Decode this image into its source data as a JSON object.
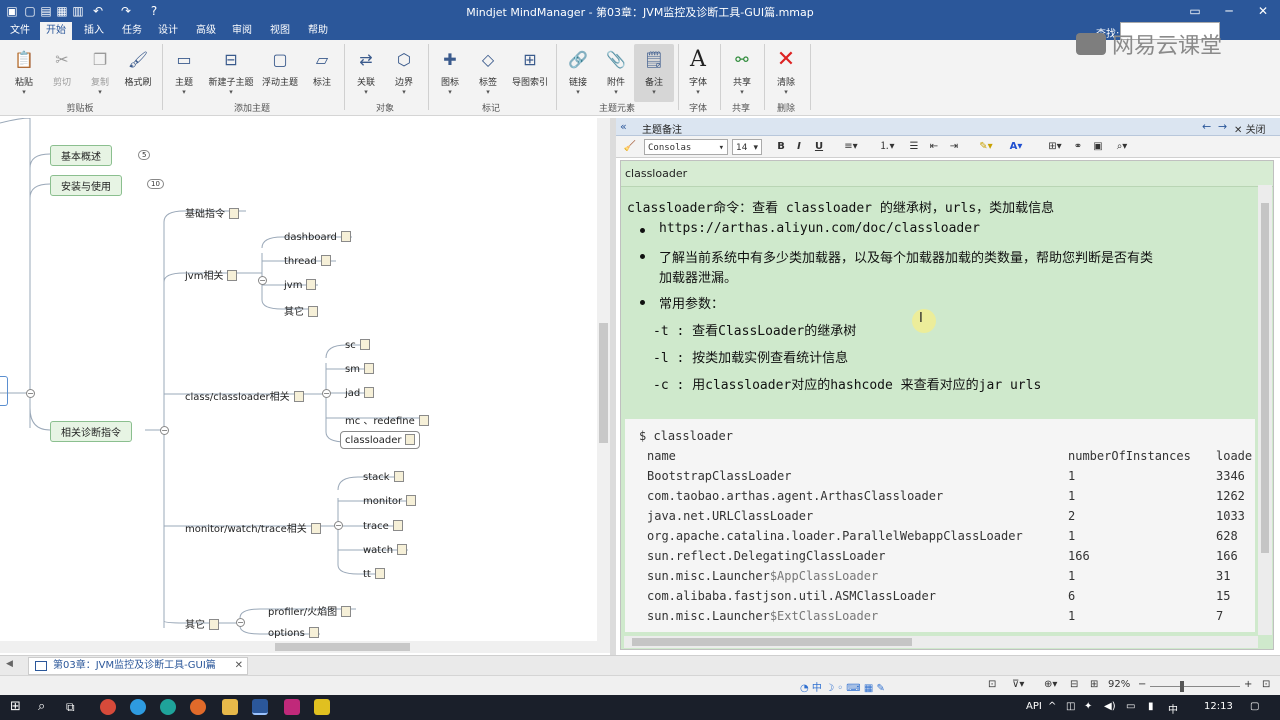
{
  "window": {
    "title": "Mindjet MindManager - 第03章：JVM监控及诊断工具-GUI篇.mmap",
    "search_label": "查找:"
  },
  "menu_tabs": [
    "文件",
    "开始",
    "插入",
    "任务",
    "设计",
    "高级",
    "审阅",
    "视图",
    "帮助"
  ],
  "ribbon": {
    "buttons": [
      {
        "label": "粘贴",
        "icon": "paste-icon"
      },
      {
        "label": "剪切",
        "icon": "cut-icon"
      },
      {
        "label": "复制",
        "icon": "copy-icon"
      },
      {
        "label": "格式刷",
        "icon": "format-painter-icon"
      },
      {
        "label": "主题",
        "icon": "topic-icon"
      },
      {
        "label": "新建子主题",
        "icon": "subtopic-icon"
      },
      {
        "label": "浮动主题",
        "icon": "floating-topic-icon"
      },
      {
        "label": "标注",
        "icon": "callout-icon"
      },
      {
        "label": "关联",
        "icon": "relationship-icon"
      },
      {
        "label": "边界",
        "icon": "boundary-icon"
      },
      {
        "label": "图标",
        "icon": "icon-icon"
      },
      {
        "label": "标签",
        "icon": "tag-icon"
      },
      {
        "label": "导图索引",
        "icon": "map-index-icon"
      },
      {
        "label": "链接",
        "icon": "link-icon"
      },
      {
        "label": "附件",
        "icon": "attachment-icon"
      },
      {
        "label": "备注",
        "icon": "notes-icon"
      },
      {
        "label": "字体",
        "icon": "font-icon"
      },
      {
        "label": "共享",
        "icon": "share-icon"
      },
      {
        "label": "清除",
        "icon": "clear-icon"
      }
    ],
    "groups": [
      "剪贴板",
      "添加主题",
      "对象",
      "标记",
      "主题元素",
      "字体",
      "共享",
      "删除"
    ]
  },
  "brand": "网易云课堂",
  "mindmap": {
    "main_nodes": [
      {
        "label": "基本概述",
        "badge": "5"
      },
      {
        "label": "安装与使用",
        "badge": "10"
      },
      {
        "label": "相关诊断指令"
      }
    ],
    "branches": [
      "基础指令",
      "jvm相关",
      "class/classloader相关",
      "monitor/watch/trace相关",
      "其它"
    ],
    "leaves_jvm": [
      "dashboard",
      "thread",
      "jvm",
      "其它"
    ],
    "leaves_class": [
      "sc",
      "sm",
      "jad",
      "mc 、redefine",
      "classloader"
    ],
    "leaves_monitor": [
      "stack",
      "monitor",
      "trace",
      "watch",
      "tt"
    ],
    "leaves_other": [
      "profiler/火焰图",
      "options"
    ]
  },
  "notes": {
    "pane_title": "主题备注",
    "close_label": "关闭",
    "font_name": "Consolas",
    "font_size": "14",
    "topic_header": "classloader",
    "intro": "classloader命令：查看 classloader 的继承树，urls，类加载信息",
    "bullets": [
      "https://arthas.aliyun.com/doc/classloader",
      "了解当前系统中有多少类加载器，以及每个加载器加载的类数量，帮助您判断是否有类",
      "加载器泄漏。",
      "常用参数："
    ],
    "params": [
      "-t : 查看ClassLoader的继承树",
      "-l : 按类加载实例查看统计信息",
      "-c : 用classloader对应的hashcode 来查看对应的jar urls"
    ],
    "code": {
      "command": "$ classloader",
      "columns": [
        "name",
        "numberOfInstances",
        "loade"
      ],
      "rows": [
        {
          "name": "BootstrapClassLoader",
          "count": "1",
          "loaded": "3346"
        },
        {
          "name": "com.taobao.arthas.agent.ArthasClassloader",
          "count": "1",
          "loaded": "1262"
        },
        {
          "name": "java.net.URLClassLoader",
          "count": "2",
          "loaded": "1033"
        },
        {
          "name": "org.apache.catalina.loader.ParallelWebappClassLoader",
          "count": "1",
          "loaded": "628"
        },
        {
          "name": "sun.reflect.DelegatingClassLoader",
          "count": "166",
          "loaded": "166"
        },
        {
          "name_a": "sun.misc.Launcher",
          "name_b": "$AppClassLoader",
          "count": "1",
          "loaded": "31"
        },
        {
          "name": "com.alibaba.fastjson.util.ASMClassLoader",
          "count": "6",
          "loaded": "15"
        },
        {
          "name_a": "sun.misc.Launcher",
          "name_b": "$ExtClassLoader",
          "count": "1",
          "loaded": "7"
        }
      ]
    }
  },
  "doc_tab": "第03章：JVM监控及诊断工具-GUI篇",
  "status": {
    "zoom": "92%"
  },
  "taskbar": {
    "ime": "中",
    "clock": "12:13",
    "api": "API"
  }
}
